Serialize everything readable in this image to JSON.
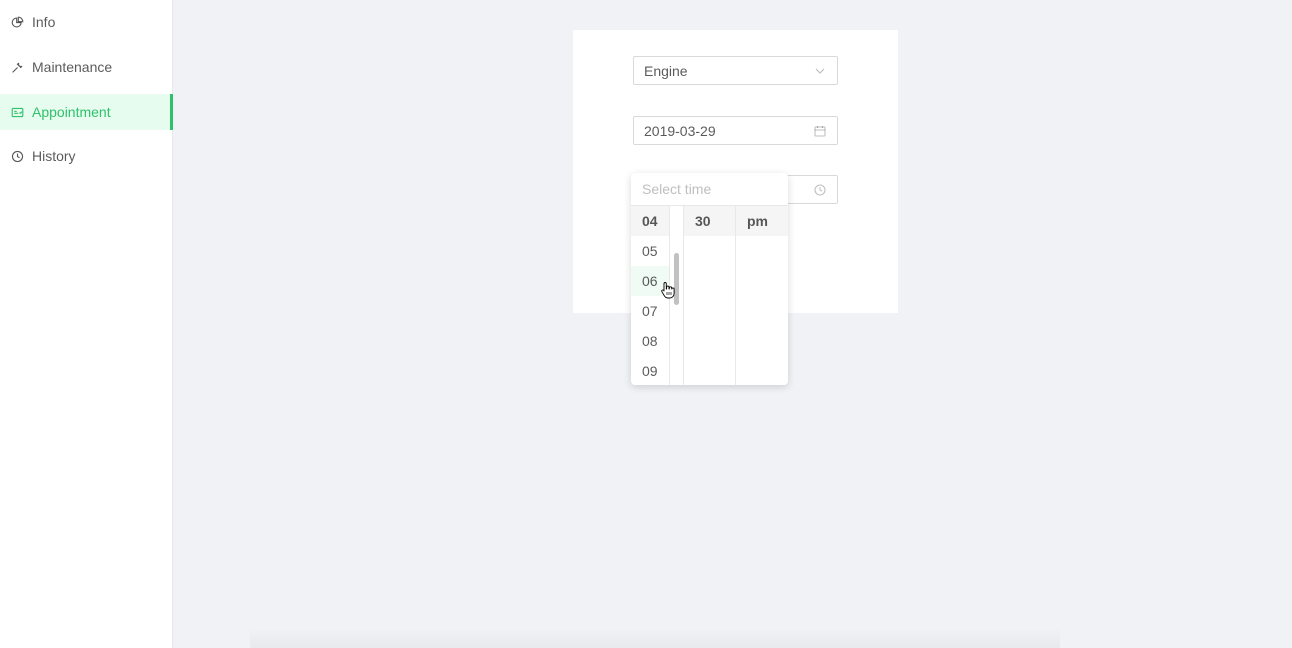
{
  "sidebar": {
    "items": [
      {
        "label": "Info",
        "icon": "pie-chart-icon"
      },
      {
        "label": "Maintenance",
        "icon": "tool-icon"
      },
      {
        "label": "Appointment",
        "icon": "schedule-icon",
        "selected": true
      },
      {
        "label": "History",
        "icon": "clock-circle-icon"
      }
    ]
  },
  "form": {
    "category_value": "Engine",
    "date_value": "2019-03-29"
  },
  "time_picker": {
    "placeholder": "Select time",
    "hours": [
      "04",
      "05",
      "06",
      "07",
      "08",
      "09"
    ],
    "selected_hour": "04",
    "hovered_hour": "06",
    "minutes": [
      "30"
    ],
    "ampm": [
      "pm"
    ]
  },
  "colors": {
    "accent": "#2fc26b",
    "selected_bg": "#e6fcef",
    "background": "#f0f2f5"
  }
}
